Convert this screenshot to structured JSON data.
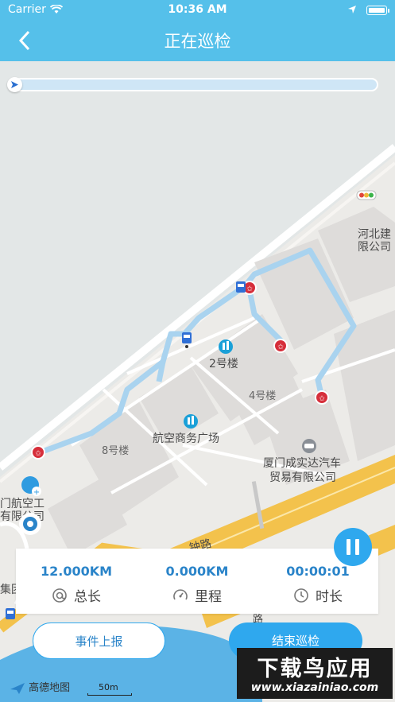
{
  "status_bar": {
    "carrier": "Carrier",
    "time": "10:36 AM"
  },
  "nav": {
    "title": "正在巡检"
  },
  "route_progress": {
    "fraction": 0.0
  },
  "map": {
    "labels": {
      "building_2": "2号楼",
      "building_4": "4号楼",
      "building_8": "8号楼",
      "plaza": "航空商务广场",
      "hebei_1": "河北建",
      "hebei_2": "限公司",
      "xiamen_car_1": "厦门成实达汽车",
      "xiamen_car_2": "贸易有限公司",
      "aviation_1": "门航空工",
      "aviation_2": "有限公司",
      "road": "钟路",
      "road2": "路",
      "group": "集团"
    },
    "colors": {
      "water": "#5bb3e6",
      "route": "#a9d3ef",
      "highway": "#f3c24c"
    }
  },
  "stats": {
    "total_length": {
      "value": "12.000KM",
      "label": "总长",
      "icon": "at-icon"
    },
    "distance": {
      "value": "0.000KM",
      "label": "里程",
      "icon": "speedometer-icon"
    },
    "duration": {
      "value": "00:00:01",
      "label": "时长",
      "icon": "clock-icon"
    }
  },
  "buttons": {
    "report": "事件上报",
    "end": "结束巡检"
  },
  "map_attribution": {
    "logo": "高德地图",
    "scale": "50m"
  },
  "watermark": {
    "title": "下载鸟应用",
    "url": "www.xiazainiao.com"
  },
  "accent": "#2fa8ee",
  "header_color": "#55c0ea"
}
